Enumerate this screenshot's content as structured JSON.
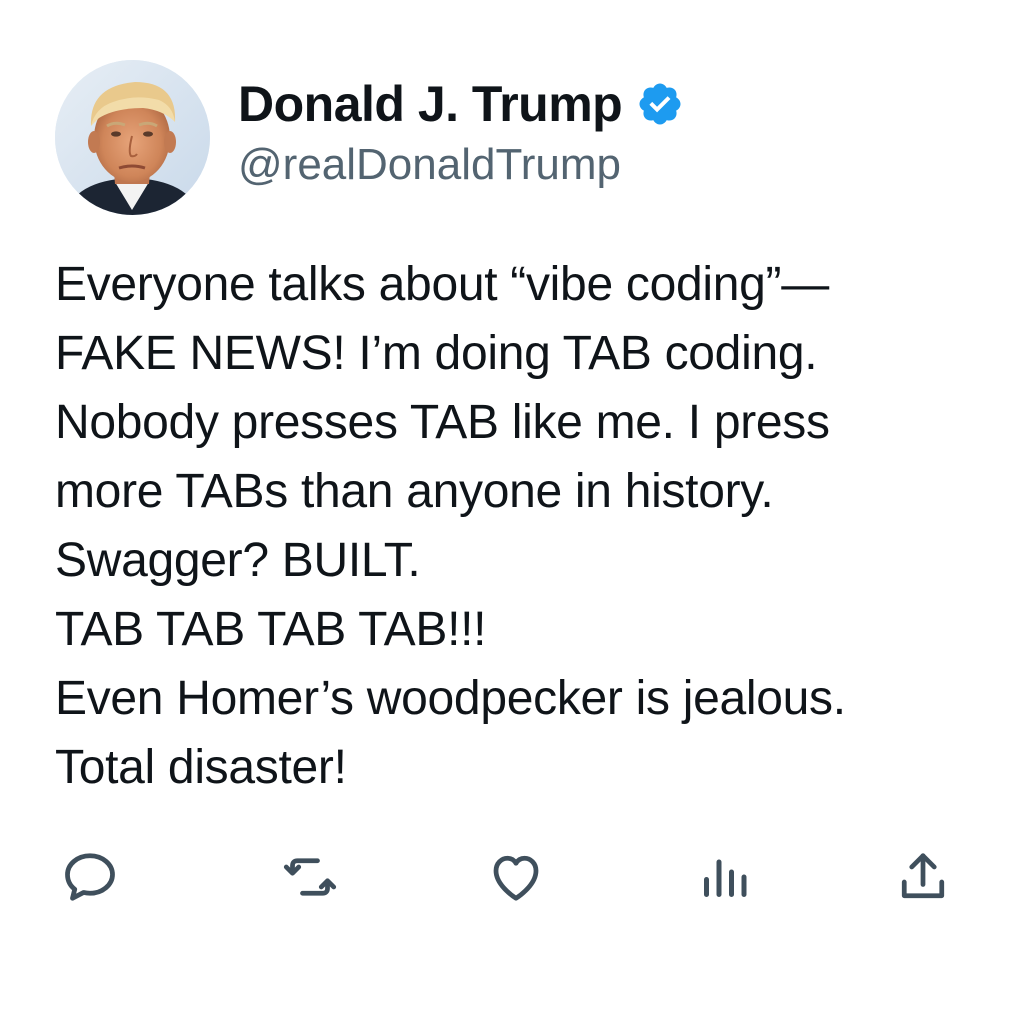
{
  "author": {
    "display_name": "Donald J. Trump",
    "handle": "@realDonaldTrump",
    "verified": true,
    "verified_color": "#1d9bf0"
  },
  "tweet": {
    "lines": [
      "Everyone talks about “vibe coding”—",
      "FAKE NEWS! I’m doing TAB coding.",
      "Nobody presses TAB like me. I press",
      "more TABs than anyone in history.",
      "Swagger? BUILT.",
      "TAB TAB TAB TAB!!!",
      "Even Homer’s woodpecker is jealous.",
      "Total disaster!"
    ]
  },
  "actions": [
    {
      "icon": "reply-icon"
    },
    {
      "icon": "retweet-icon"
    },
    {
      "icon": "like-icon"
    },
    {
      "icon": "views-icon"
    },
    {
      "icon": "share-icon"
    }
  ],
  "colors": {
    "text": "#0f1419",
    "secondary": "#536471",
    "icon": "#3f4f5c"
  }
}
